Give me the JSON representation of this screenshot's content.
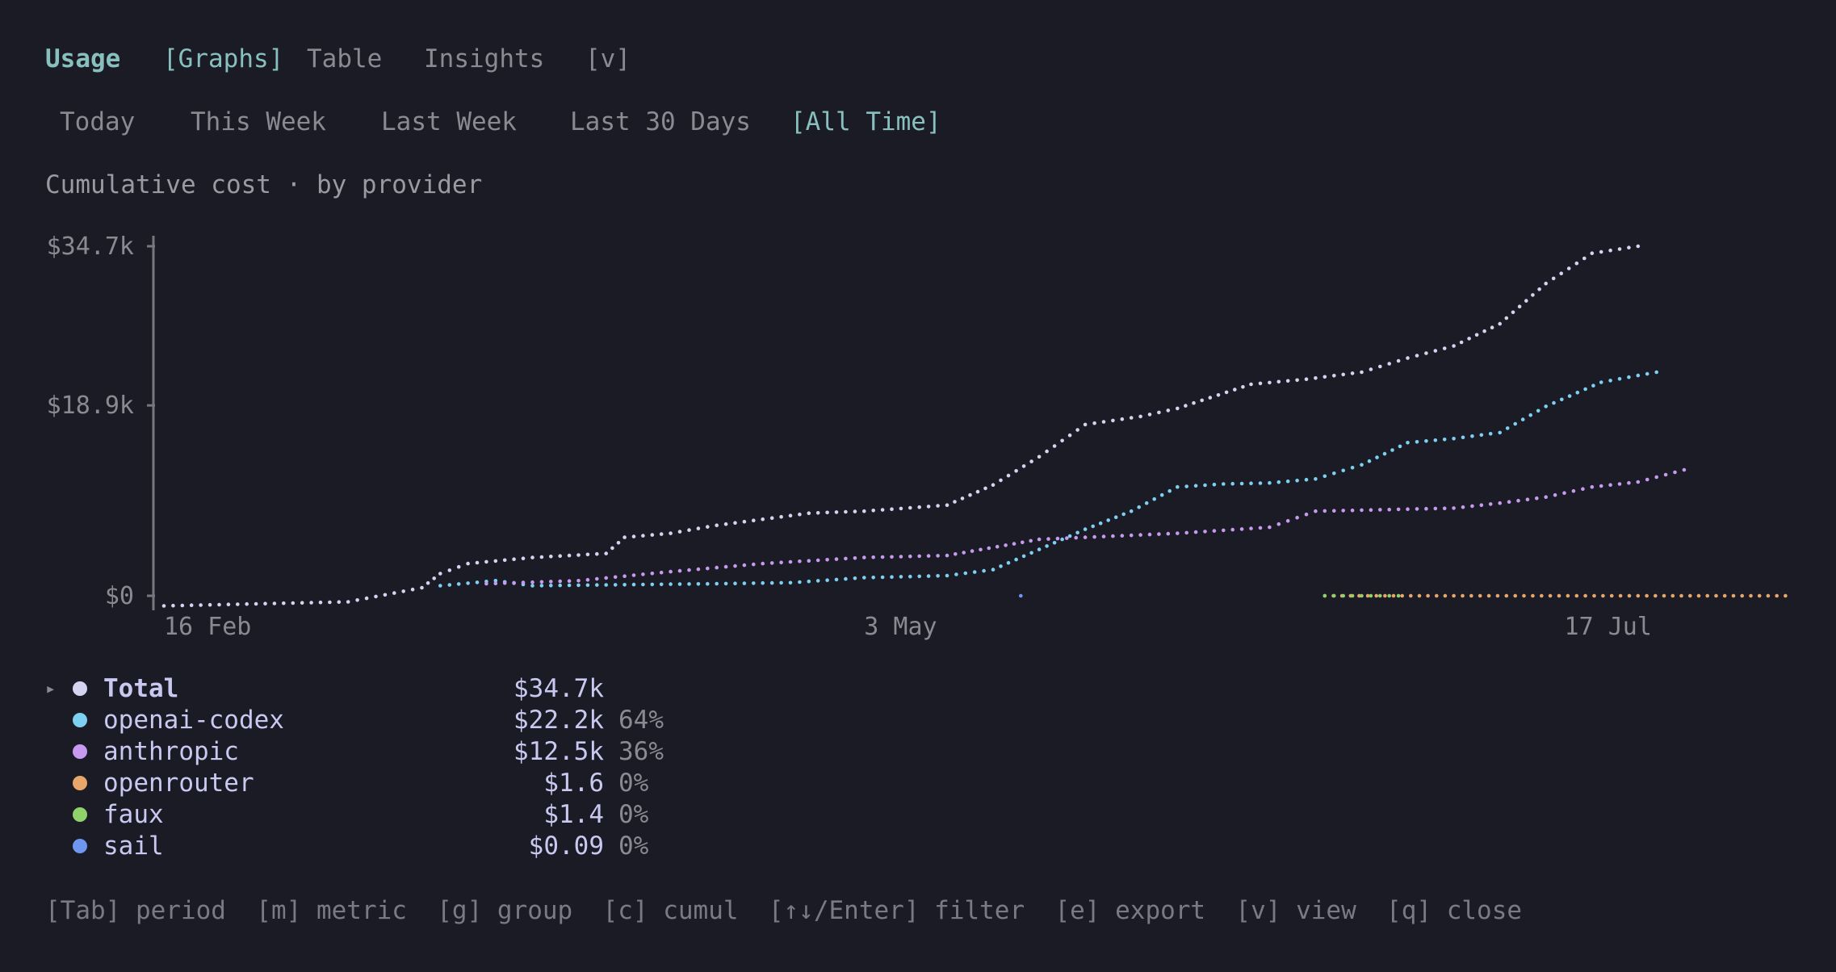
{
  "nav": {
    "title": "Usage",
    "tabs": [
      {
        "label": "[Graphs]",
        "active": true
      },
      {
        "label": "Table",
        "active": false
      },
      {
        "label": "Insights",
        "active": false
      },
      {
        "label": "[v]",
        "active": false
      }
    ]
  },
  "periods": [
    {
      "label": "Today",
      "active": false
    },
    {
      "label": "This Week",
      "active": false
    },
    {
      "label": "Last Week",
      "active": false
    },
    {
      "label": "Last 30 Days",
      "active": false
    },
    {
      "label": "[All Time]",
      "active": true
    }
  ],
  "chart_title": "Cumulative cost · by provider",
  "chart_data": {
    "type": "line",
    "title": "Cumulative cost · by provider",
    "cumulative": true,
    "y_tick_labels": [
      "$34.7k",
      "$18.9k",
      "$0"
    ],
    "y_ticks": [
      34700,
      18900,
      0
    ],
    "ylim": [
      0,
      34700
    ],
    "x_tick_labels": [
      "16 Feb",
      "3 May",
      "17 Jul"
    ],
    "x_ticks": [
      0,
      76,
      152
    ],
    "xlim": [
      0,
      175
    ],
    "series": [
      {
        "name": "Total",
        "color": "#d4d4f0",
        "x": [
          0,
          10,
          20,
          28,
          30,
          33,
          40,
          48,
          50,
          55,
          60,
          65,
          70,
          76,
          85,
          90,
          95,
          100,
          106,
          110,
          118,
          124,
          130,
          135,
          140,
          145,
          150,
          155,
          160
        ],
        "y": [
          -1000,
          -800,
          -600,
          800,
          2200,
          3200,
          3800,
          4200,
          5800,
          6200,
          7000,
          7600,
          8200,
          8400,
          9000,
          11000,
          13800,
          17000,
          17800,
          18600,
          21000,
          21500,
          22200,
          23600,
          24800,
          27000,
          31000,
          34000,
          34700
        ]
      },
      {
        "name": "openai-codex",
        "color": "#7dd0f0",
        "x": [
          30,
          36,
          40,
          50,
          60,
          68,
          76,
          85,
          90,
          95,
          100,
          105,
          110,
          115,
          120,
          125,
          130,
          135,
          140,
          145,
          150,
          156,
          162
        ],
        "y": [
          1000,
          1500,
          1000,
          1100,
          1200,
          1300,
          1800,
          2000,
          2600,
          4600,
          6600,
          8400,
          10800,
          11100,
          11200,
          11600,
          13000,
          15200,
          15600,
          16200,
          18800,
          21200,
          22200
        ]
      },
      {
        "name": "anthropic",
        "color": "#c79af0",
        "x": [
          35,
          45,
          55,
          65,
          76,
          85,
          95,
          100,
          110,
          120,
          125,
          135,
          140,
          145,
          150,
          155,
          160,
          165
        ],
        "y": [
          1200,
          1500,
          2400,
          3200,
          3800,
          4000,
          5600,
          5800,
          6200,
          6800,
          8400,
          8600,
          8700,
          9200,
          9800,
          10800,
          11300,
          12500
        ]
      },
      {
        "name": "openrouter",
        "color": "#e8a66a",
        "x": [
          126,
          140,
          160,
          176
        ],
        "y": [
          0.2,
          0.6,
          1.2,
          1.6
        ]
      },
      {
        "name": "faux",
        "color": "#8fd16a",
        "x": [
          126,
          134
        ],
        "y": [
          0.8,
          1.4
        ]
      },
      {
        "name": "sail",
        "color": "#6f96f0",
        "x": [
          93
        ],
        "y": [
          0.09
        ]
      }
    ]
  },
  "legend": [
    {
      "name": "Total",
      "value": "$34.7k",
      "pct": "",
      "color": "#d4d4f0",
      "selected": true,
      "arrow": "▸"
    },
    {
      "name": "openai-codex",
      "value": "$22.2k",
      "pct": "64%",
      "color": "#7dd0f0",
      "selected": false,
      "arrow": ""
    },
    {
      "name": "anthropic",
      "value": "$12.5k",
      "pct": "36%",
      "color": "#c79af0",
      "selected": false,
      "arrow": ""
    },
    {
      "name": "openrouter",
      "value": "$1.6",
      "pct": "0%",
      "color": "#e8a66a",
      "selected": false,
      "arrow": ""
    },
    {
      "name": "faux",
      "value": "$1.4",
      "pct": "0%",
      "color": "#8fd16a",
      "selected": false,
      "arrow": ""
    },
    {
      "name": "sail",
      "value": "$0.09",
      "pct": "0%",
      "color": "#6f96f0",
      "selected": false,
      "arrow": ""
    }
  ],
  "footer": "[Tab] period  [m] metric  [g] group  [c] cumul  [↑↓/Enter] filter  [e] export  [v] view  [q] close"
}
